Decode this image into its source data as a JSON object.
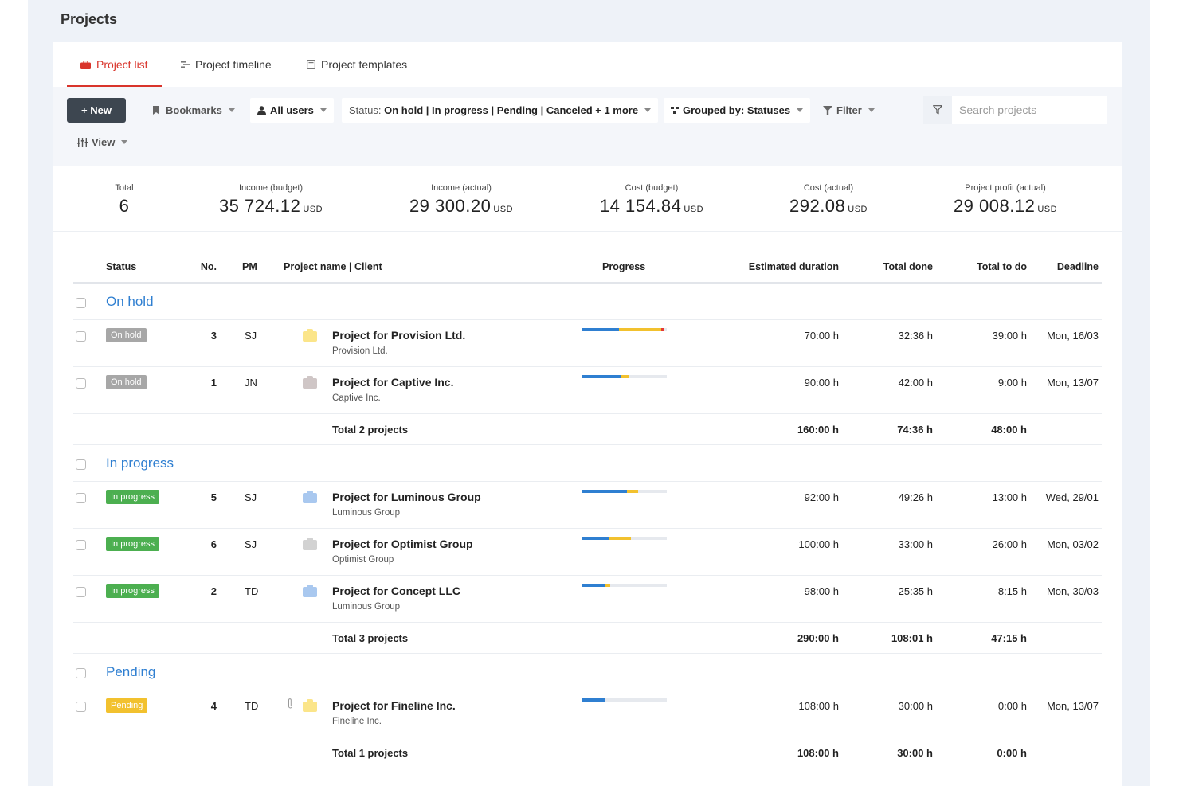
{
  "page": {
    "title": "Projects"
  },
  "tabs": [
    {
      "label": "Project list",
      "active": true,
      "icon": "briefcase-icon"
    },
    {
      "label": "Project timeline",
      "active": false,
      "icon": "timeline-icon"
    },
    {
      "label": "Project templates",
      "active": false,
      "icon": "template-icon"
    }
  ],
  "toolbar": {
    "new_label": "+ New",
    "bookmarks_label": "Bookmarks",
    "users_label": "All users",
    "status_prefix": "Status:",
    "status_value": "On hold | In progress | Pending | Canceled + 1 more",
    "grouped_prefix": "Grouped by:",
    "grouped_value": "Statuses",
    "filter_label": "Filter",
    "view_label": "View",
    "search_placeholder": "Search projects"
  },
  "summary": {
    "total": {
      "label": "Total",
      "value": "6"
    },
    "income_budget": {
      "label": "Income (budget)",
      "value": "35 724.12",
      "currency": "USD"
    },
    "income_actual": {
      "label": "Income (actual)",
      "value": "29 300.20",
      "currency": "USD"
    },
    "cost_budget": {
      "label": "Cost (budget)",
      "value": "14 154.84",
      "currency": "USD"
    },
    "cost_actual": {
      "label": "Cost (actual)",
      "value": "292.08",
      "currency": "USD"
    },
    "profit_actual": {
      "label": "Project profit (actual)",
      "value": "29 008.12",
      "currency": "USD"
    }
  },
  "columns": {
    "status": "Status",
    "no": "No.",
    "pm": "PM",
    "name_client": "Project name | Client",
    "progress": "Progress",
    "estimated": "Estimated duration",
    "done": "Total done",
    "todo": "Total to do",
    "deadline": "Deadline"
  },
  "groups": {
    "on_hold": {
      "title": "On hold",
      "rows": [
        {
          "status": "On hold",
          "no": "3",
          "pm": "SJ",
          "name": "Project for Provision Ltd.",
          "client": "Provision Ltd.",
          "folder_color": "#fbe58a",
          "progress": [
            0.43,
            0.5,
            0.04
          ],
          "estimated": "70:00 h",
          "done": "32:36 h",
          "todo": "39:00 h",
          "deadline": "Mon, 16/03"
        },
        {
          "status": "On hold",
          "no": "1",
          "pm": "JN",
          "name": "Project for Captive Inc.",
          "client": "Captive Inc.",
          "folder_color": "#cfc6c6",
          "progress": [
            0.46,
            0.09,
            0
          ],
          "estimated": "90:00 h",
          "done": "42:00 h",
          "todo": "9:00 h",
          "deadline": "Mon, 13/07"
        }
      ],
      "total": {
        "label": "Total 2 projects",
        "estimated": "160:00 h",
        "done": "74:36 h",
        "todo": "48:00 h"
      }
    },
    "in_progress": {
      "title": "In progress",
      "rows": [
        {
          "status": "In progress",
          "no": "5",
          "pm": "SJ",
          "name": "Project for Luminous Group",
          "client": "Luminous Group",
          "folder_color": "#a9c8ef",
          "progress": [
            0.53,
            0.13,
            0
          ],
          "estimated": "92:00 h",
          "done": "49:26 h",
          "todo": "13:00 h",
          "deadline": "Wed, 29/01"
        },
        {
          "status": "In progress",
          "no": "6",
          "pm": "SJ",
          "name": "Project for Optimist Group",
          "client": "Optimist Group",
          "folder_color": "#d2d2d2",
          "progress": [
            0.32,
            0.26,
            0
          ],
          "estimated": "100:00 h",
          "done": "33:00 h",
          "todo": "26:00 h",
          "deadline": "Mon, 03/02"
        },
        {
          "status": "In progress",
          "no": "2",
          "pm": "TD",
          "name": "Project for Concept LLC",
          "client": "Luminous Group",
          "folder_color": "#a9c8ef",
          "progress": [
            0.26,
            0.07,
            0
          ],
          "estimated": "98:00 h",
          "done": "25:35 h",
          "todo": "8:15 h",
          "deadline": "Mon, 30/03"
        }
      ],
      "total": {
        "label": "Total 3 projects",
        "estimated": "290:00 h",
        "done": "108:01 h",
        "todo": "47:15 h"
      }
    },
    "pending": {
      "title": "Pending",
      "rows": [
        {
          "status": "Pending",
          "no": "4",
          "pm": "TD",
          "name": "Project for Fineline Inc.",
          "client": "Fineline Inc.",
          "folder_color": "#fbe58a",
          "progress": [
            0.26,
            0,
            0
          ],
          "estimated": "108:00 h",
          "done": "30:00 h",
          "todo": "0:00 h",
          "deadline": "Mon, 13/07"
        }
      ],
      "total": {
        "label": "Total 1 projects",
        "estimated": "108:00 h",
        "done": "30:00 h",
        "todo": "0:00 h"
      }
    }
  },
  "colors": {
    "accent": "#d9342b",
    "group_title": "#2f7fd1",
    "progress_done": "#2f7fd1",
    "progress_todo": "#f2c12e",
    "progress_over": "#e53935",
    "badge_on_hold": "#a7a7a7",
    "badge_in_progress": "#4caf50",
    "badge_pending": "#f2c12e"
  }
}
